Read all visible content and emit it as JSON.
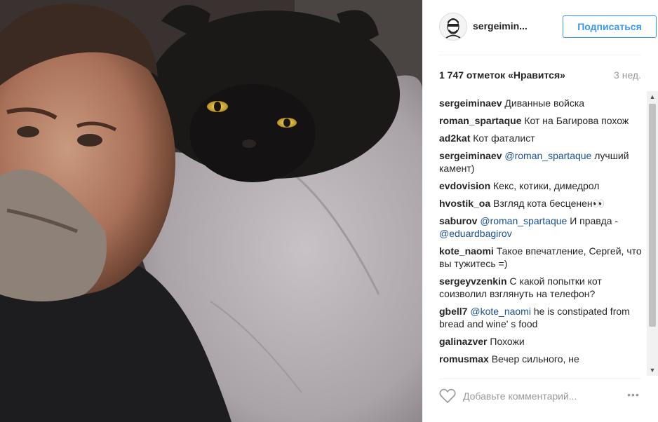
{
  "post": {
    "username": "sergeimin...",
    "follow_label": "Подписаться",
    "likes": "1 747 отметок «Нравится»",
    "age": "3 нед.",
    "comments": [
      {
        "user": "sergeiminaev",
        "text": "Диванные войска"
      },
      {
        "user": "roman_spartaque",
        "text": "Кот на Багирова похож"
      },
      {
        "user": "ad2kat",
        "text": "Кот фаталист"
      },
      {
        "user": "sergeiminaev",
        "mention": "@roman_spartaque",
        "text": "лучший камент)"
      },
      {
        "user": "evdovision",
        "text": "Кекс, котики, димедрол"
      },
      {
        "user": "hvostik_oa",
        "text": "Взгляд кота бесценен👀"
      },
      {
        "user": "saburov",
        "mention": "@roman_spartaque",
        "text": "И правда -",
        "mention2": "@eduardbagirov"
      },
      {
        "user": "kote_naomi",
        "text": "Такое впечатление, Сергей, что вы тужитесь =)"
      },
      {
        "user": "sergeyvzenkin",
        "text": "С какой попытки кот соизволил взглянуть на телефон?"
      },
      {
        "user": "gbell7",
        "mention": "@kote_naomi",
        "text": "he is constipated from bread and wine' s food"
      },
      {
        "user": "galinazver",
        "text": "Похожи"
      },
      {
        "user": "romusmax",
        "text": "Вечер сильного, не"
      }
    ],
    "comment_placeholder": "Добавьте комментарий...",
    "more_label": "•••"
  },
  "icons": {
    "avatar": "avatar-icon",
    "like": "heart-icon",
    "more": "more-options-icon"
  },
  "colors": {
    "accent": "#3897f0",
    "mention": "#1a4f8f",
    "muted": "#999999"
  }
}
